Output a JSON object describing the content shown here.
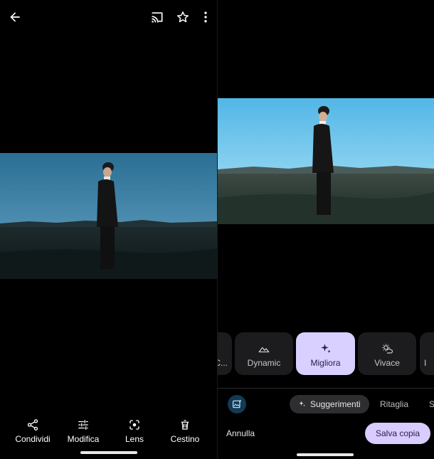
{
  "left": {
    "top_icons": [
      "back-arrow-icon",
      "cast-icon",
      "star-icon",
      "more-vert-icon"
    ],
    "actions": [
      {
        "label": "Condividi",
        "icon": "share-icon"
      },
      {
        "label": "Modifica",
        "icon": "tune-icon"
      },
      {
        "label": "Lens",
        "icon": "lens-icon"
      },
      {
        "label": "Cestino",
        "icon": "trash-icon"
      }
    ]
  },
  "right": {
    "filters": [
      {
        "label": "C...",
        "icon": ""
      },
      {
        "label": "Dynamic",
        "icon": "mountain-icon"
      },
      {
        "label": "Migliora",
        "icon": "sparkle-icon",
        "selected": true
      },
      {
        "label": "Vivace",
        "icon": "sun-cloud-icon"
      },
      {
        "label": "I",
        "icon": ""
      }
    ],
    "tools": {
      "suggestions_chip": "Suggerimenti",
      "crop_tab": "Ritaglia",
      "next_tab": "S"
    },
    "cancel_label": "Annulla",
    "save_label": "Salva copia"
  },
  "colors": {
    "selected_filter_bg": "#d9d0ff",
    "save_button_bg": "#d9ccff",
    "background": "#000000"
  }
}
